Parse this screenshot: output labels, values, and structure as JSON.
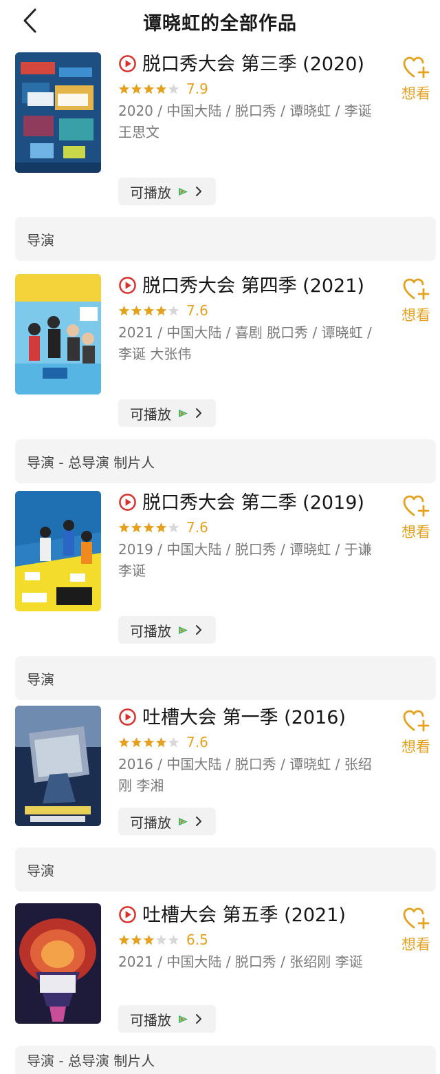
{
  "header": {
    "title": "谭晓虹的全部作品",
    "back_icon": "chevron-left-icon"
  },
  "colors": {
    "accent": "#e5a01d",
    "play_red": "#d9302b",
    "star_empty": "#d8d8d8"
  },
  "works": [
    {
      "title": "脱口秀大会 第三季 (2020)",
      "rating": 7.9,
      "stars_filled": 4,
      "meta": "2020 / 中国大陆 / 脱口秀 / 谭晓虹 / 李诞 王思文",
      "playable_label": "可播放",
      "want_label": "想看",
      "role": "导演"
    },
    {
      "title": "脱口秀大会 第四季 (2021)",
      "rating": 7.6,
      "stars_filled": 4,
      "meta": "2021 / 中国大陆 / 喜剧 脱口秀 / 谭晓虹 / 李诞 大张伟",
      "playable_label": "可播放",
      "want_label": "想看",
      "role": "导演 - 总导演 制片人"
    },
    {
      "title": "脱口秀大会 第二季 (2019)",
      "rating": 7.6,
      "stars_filled": 4,
      "meta": "2019 / 中国大陆 / 脱口秀 / 谭晓虹 / 于谦 李诞",
      "playable_label": "可播放",
      "want_label": "想看",
      "role": "导演"
    },
    {
      "title": "吐槽大会 第一季 (2016)",
      "rating": 7.6,
      "stars_filled": 4,
      "meta": "2016 / 中国大陆 / 脱口秀 / 谭晓虹 / 张绍刚 李湘",
      "playable_label": "可播放",
      "want_label": "想看",
      "role": "导演"
    },
    {
      "title": "吐槽大会 第五季 (2021)",
      "rating": 6.5,
      "stars_filled": 3,
      "meta": "2021 / 中国大陆 / 脱口秀 / 张绍刚 李诞",
      "playable_label": "可播放",
      "want_label": "想看",
      "role": "导演 - 总导演 制片人"
    }
  ]
}
